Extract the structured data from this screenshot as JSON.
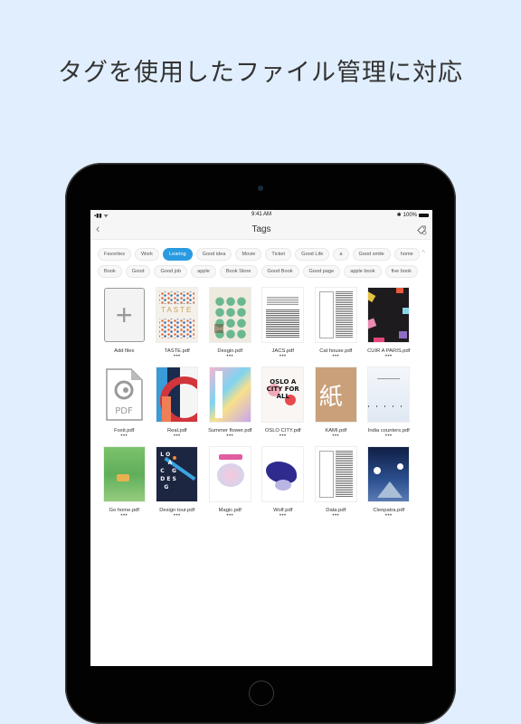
{
  "headline": "タグを使用したファイル管理に対応",
  "statusbar": {
    "time": "9:41 AM",
    "battery": "100%",
    "bluetooth": "✱",
    "signal": "▪▪▮",
    "wifi": "≋"
  },
  "navbar": {
    "back_icon": "‹",
    "title": "Tags",
    "tag_icon": "tag-settings-icon"
  },
  "tags": {
    "row1": [
      "Favorites",
      "Work",
      "Learing",
      "Good idea",
      "Movie",
      "Ticket",
      "Good Life",
      "a",
      "Good smile",
      "home"
    ],
    "row2": [
      "Book",
      "Good",
      "Good job",
      "apple",
      "Book Store",
      "Good Book",
      "Good page",
      "apple book",
      "five book"
    ],
    "active": "Learing",
    "collapse_icon": "^"
  },
  "accent_color": "#2a9be0",
  "more_label": "•••",
  "files": [
    {
      "name": "Add files"
    },
    {
      "name": "TASTE.pdf"
    },
    {
      "name": "Desgin.pdf"
    },
    {
      "name": "JACS.pdf"
    },
    {
      "name": "Cat house.pdf"
    },
    {
      "name": "CUIR A PARIS.pdf"
    },
    {
      "name": "Foxit.pdf"
    },
    {
      "name": "Real.pdf"
    },
    {
      "name": "Summer flower.pdf"
    },
    {
      "name": "OSLO CITY.pdf"
    },
    {
      "name": "KAMI.pdf"
    },
    {
      "name": "India counters.pdf"
    },
    {
      "name": "Go home.pdf"
    },
    {
      "name": "Design tour.pdf"
    },
    {
      "name": "Magic.pdf"
    },
    {
      "name": "Wolf.pdf"
    },
    {
      "name": "Data.pdf"
    },
    {
      "name": "Cleopatra.pdf"
    }
  ],
  "thumb_text": {
    "taste": "TASTE",
    "oslo": "OSLO A CITY FOR ALL",
    "kami": "紙",
    "pdf": "PDF",
    "plus": "+"
  }
}
